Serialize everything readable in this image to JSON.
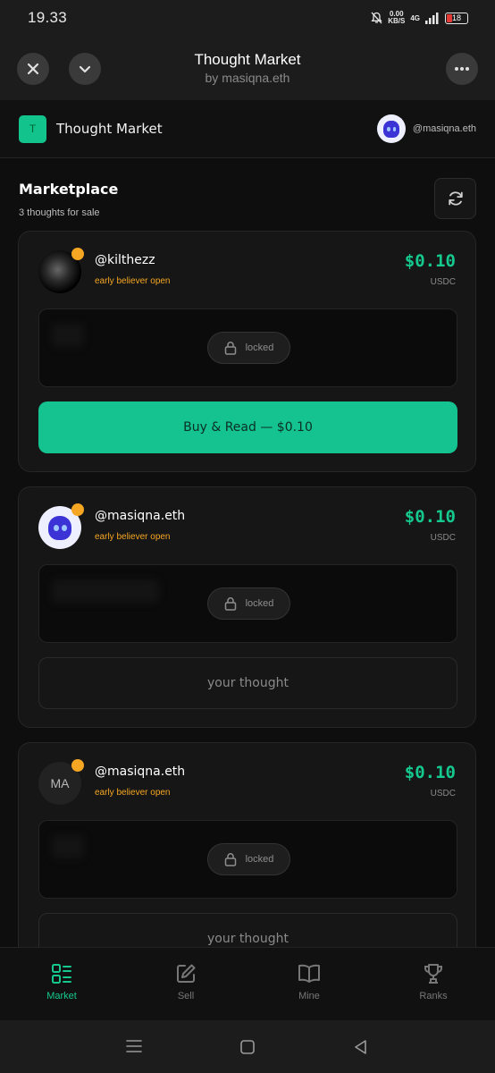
{
  "status_bar": {
    "time": "19.33",
    "net_speed": "0.00",
    "net_unit": "KB/S",
    "network": "4G",
    "battery": "18"
  },
  "browser": {
    "title": "Thought Market",
    "subtitle": "by masiqna.eth"
  },
  "app": {
    "logo_letter": "T",
    "name": "Thought Market",
    "user": "@masiqna.eth"
  },
  "marketplace": {
    "title": "Marketplace",
    "subtitle": "3 thoughts for sale"
  },
  "cards": [
    {
      "user": "@kilthezz",
      "tag": "early believer open",
      "price": "$0.10",
      "unit": "USDC",
      "locked_label": "locked",
      "action": "Buy & Read — $0.10"
    },
    {
      "user": "@masiqna.eth",
      "tag": "early believer open",
      "price": "$0.10",
      "unit": "USDC",
      "locked_label": "locked",
      "action": "your thought"
    },
    {
      "user": "@masiqna.eth",
      "avatar_initials": "MA",
      "tag": "early believer open",
      "price": "$0.10",
      "unit": "USDC",
      "locked_label": "locked",
      "action": "your thought"
    }
  ],
  "nav": {
    "items": [
      {
        "label": "Market",
        "icon": "market-icon",
        "active": true
      },
      {
        "label": "Sell",
        "icon": "edit-icon"
      },
      {
        "label": "Mine",
        "icon": "book-icon"
      },
      {
        "label": "Ranks",
        "icon": "trophy-icon"
      }
    ]
  },
  "colors": {
    "accent": "#15c98e",
    "badge": "#f5a623",
    "background": "#0e0e0e"
  }
}
